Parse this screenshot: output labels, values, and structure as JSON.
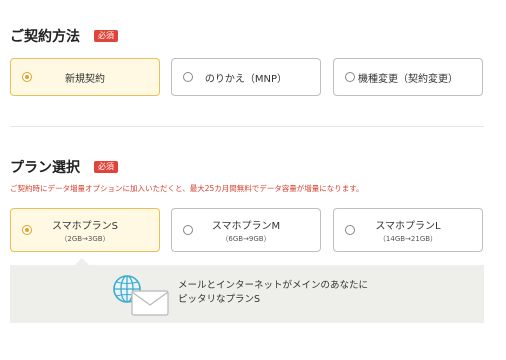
{
  "contract": {
    "title": "ご契約方法",
    "required_badge": "必須",
    "options": [
      {
        "label": "新規契約",
        "selected": true
      },
      {
        "label": "のりかえ（MNP）",
        "selected": false
      },
      {
        "label": "機種変更（契約変更）",
        "selected": false
      }
    ]
  },
  "plan": {
    "title": "プラン選択",
    "required_badge": "必須",
    "notice": "ご契約時にデータ増量オプションに加入いただくと、最大25カ月間無料でデータ容量が増量になります。",
    "options": [
      {
        "name": "スマホプランS",
        "detail": "（2GB→3GB）",
        "selected": true
      },
      {
        "name": "スマホプランM",
        "detail": "（6GB→9GB）",
        "selected": false
      },
      {
        "name": "スマホプランL",
        "detail": "（14GB→21GB）",
        "selected": false
      }
    ]
  },
  "info": {
    "line1": "メールとインターネットがメインのあなたに",
    "line2": "ピッタリなプランS",
    "icon": "globe-mail-icon"
  },
  "colors": {
    "selected_border": "#e7c05a",
    "selected_bg": "#fff9e3",
    "badge": "#e0433a",
    "notice": "#d6402e",
    "info_bg": "#eeeeea"
  }
}
